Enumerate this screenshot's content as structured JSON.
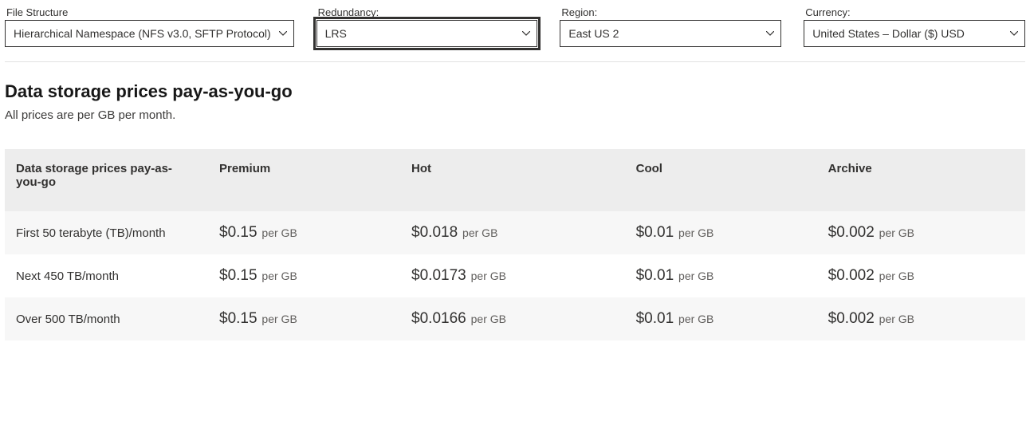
{
  "filters": {
    "file_structure": {
      "label": "File Structure",
      "value": "Hierarchical Namespace (NFS v3.0, SFTP Protocol)"
    },
    "redundancy": {
      "label": "Redundancy:",
      "value": "LRS"
    },
    "region": {
      "label": "Region:",
      "value": "East US 2"
    },
    "currency": {
      "label": "Currency:",
      "value": "United States – Dollar ($) USD"
    }
  },
  "section": {
    "title": "Data storage prices pay-as-you-go",
    "subtitle": "All prices are per GB per month."
  },
  "table": {
    "columns": [
      "Data storage prices pay-as-you-go",
      "Premium",
      "Hot",
      "Cool",
      "Archive"
    ],
    "unit": "per GB",
    "rows": [
      {
        "label": "First 50 terabyte (TB)/month",
        "cells": [
          "$0.15",
          "$0.018",
          "$0.01",
          "$0.002"
        ]
      },
      {
        "label": "Next 450 TB/month",
        "cells": [
          "$0.15",
          "$0.0173",
          "$0.01",
          "$0.002"
        ]
      },
      {
        "label": "Over 500 TB/month",
        "cells": [
          "$0.15",
          "$0.0166",
          "$0.01",
          "$0.002"
        ]
      }
    ]
  },
  "chart_data": {
    "type": "table",
    "title": "Data storage prices pay-as-you-go",
    "unit": "USD per GB per month",
    "categories": [
      "First 50 terabyte (TB)/month",
      "Next 450 TB/month",
      "Over 500 TB/month"
    ],
    "series": [
      {
        "name": "Premium",
        "values": [
          0.15,
          0.15,
          0.15
        ]
      },
      {
        "name": "Hot",
        "values": [
          0.018,
          0.0173,
          0.0166
        ]
      },
      {
        "name": "Cool",
        "values": [
          0.01,
          0.01,
          0.01
        ]
      },
      {
        "name": "Archive",
        "values": [
          0.002,
          0.002,
          0.002
        ]
      }
    ]
  }
}
